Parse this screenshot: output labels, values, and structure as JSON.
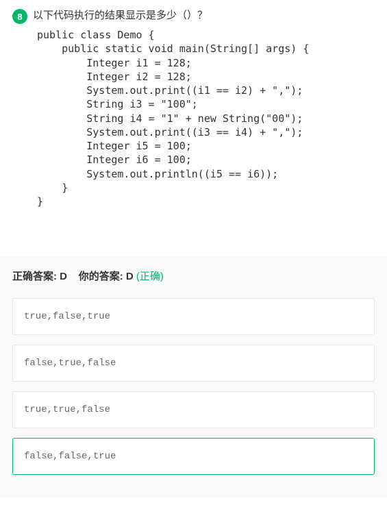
{
  "question": {
    "number": "8",
    "title": "以下代码执行的结果显示是多少（）？",
    "code": "public class Demo {\n    public static void main(String[] args) {\n        Integer i1 = 128;\n        Integer i2 = 128;\n        System.out.print((i1 == i2) + \",\");\n        String i3 = \"100\";\n        String i4 = \"1\" + new String(\"00\");\n        System.out.print((i3 == i4) + \",\");\n        Integer i5 = 100;\n        Integer i6 = 100;\n        System.out.println((i5 == i6));\n    }\n}"
  },
  "answer": {
    "correct_label": "正确答案:",
    "correct_value": "D",
    "your_label": "你的答案:",
    "your_value": "D",
    "your_status": "(正确)"
  },
  "options": [
    {
      "text": "true,false,true",
      "selected": false
    },
    {
      "text": "false,true,false",
      "selected": false
    },
    {
      "text": "true,true,false",
      "selected": false
    },
    {
      "text": "false,false,true",
      "selected": true
    }
  ]
}
